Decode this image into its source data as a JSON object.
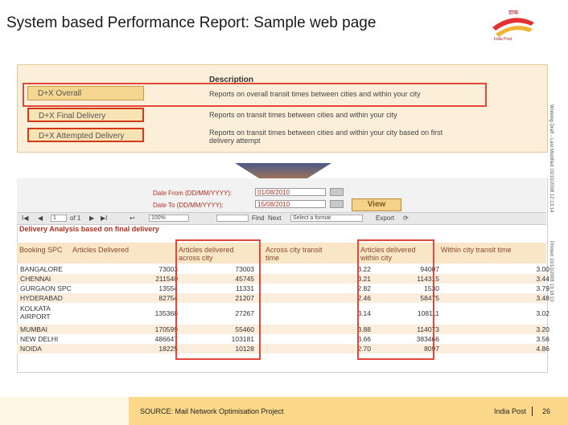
{
  "title": "System based Performance Report: Sample web page",
  "logo": {
    "brand_text": "India Post"
  },
  "upper": {
    "header": "Description",
    "options": [
      {
        "label": "D+X Overall",
        "description": "Reports on overall transit times between cities and within your city"
      },
      {
        "label": "D+X Final Delivery",
        "description": "Reports on transit times between cities and within your city"
      },
      {
        "label": "D+X Attempted Delivery",
        "description": "Reports on transit times between cities and within your city based on first delivery attempt"
      }
    ]
  },
  "form": {
    "date_from_label": "Date From (DD/MM/YYYY):",
    "date_to_label": "Date To (DD/MM/YYYY):",
    "date_from_value": "01/08/2010",
    "date_to_value": "15/08/2010",
    "view_button": "View"
  },
  "toolbar": {
    "page": "1",
    "of_pages": "of 1",
    "zoom": "100%",
    "find": "Find",
    "next": "Next",
    "format": "Select a format",
    "export": "Export"
  },
  "report": {
    "title": "Delivery Analysis based on final delivery",
    "columns": [
      "Booking SPC",
      "Articles Delivered",
      "Articles delivered across city",
      "Across city transit time",
      "Articles delivered within city",
      "Within city transit time"
    ],
    "rows": [
      {
        "spc": "BANGALORE",
        "delivered": "73003",
        "across": "73003",
        "across_time": "3.22",
        "within": "94007",
        "within_time": "3.00"
      },
      {
        "spc": "CHENNAI",
        "delivered": "211540",
        "across": "45745",
        "across_time": "3.21",
        "within": "114315",
        "within_time": "3.44"
      },
      {
        "spc": "GURGAON SPC",
        "delivered": "13554",
        "across": "11331",
        "across_time": "2.82",
        "within": "1530",
        "within_time": "3.79"
      },
      {
        "spc": "HYDERABAD",
        "delivered": "82754",
        "across": "21207",
        "across_time": "2.46",
        "within": "58475",
        "within_time": "3.48"
      },
      {
        "spc": "KOLKATA AIRPORT",
        "delivered": "135368",
        "across": "27267",
        "across_time": "3.14",
        "within": "108111",
        "within_time": "3.02"
      },
      {
        "spc": "MUMBAI",
        "delivered": "170599",
        "across": "55460",
        "across_time": "3.88",
        "within": "114073",
        "within_time": "3.20"
      },
      {
        "spc": "NEW DELHI",
        "delivered": "486647",
        "across": "103181",
        "across_time": "3.66",
        "within": "383466",
        "within_time": "3.56"
      },
      {
        "spc": "NOIDA",
        "delivered": "18225",
        "across": "10128",
        "across_time": "2.70",
        "within": "8097",
        "within_time": "4.86"
      }
    ]
  },
  "side_notes": {
    "note1": "Working Draft - Last Modified 10/10/2008 12:13:14",
    "note2": "Printed 10/10/2008 13:18:10"
  },
  "footer": {
    "source": "SOURCE: Mail Network Optimisation Project",
    "brand": "India Post",
    "page": "26"
  },
  "colors": {
    "accent": "#fcd98a",
    "highlight": "#e2473a",
    "brand_red": "#b52025"
  }
}
